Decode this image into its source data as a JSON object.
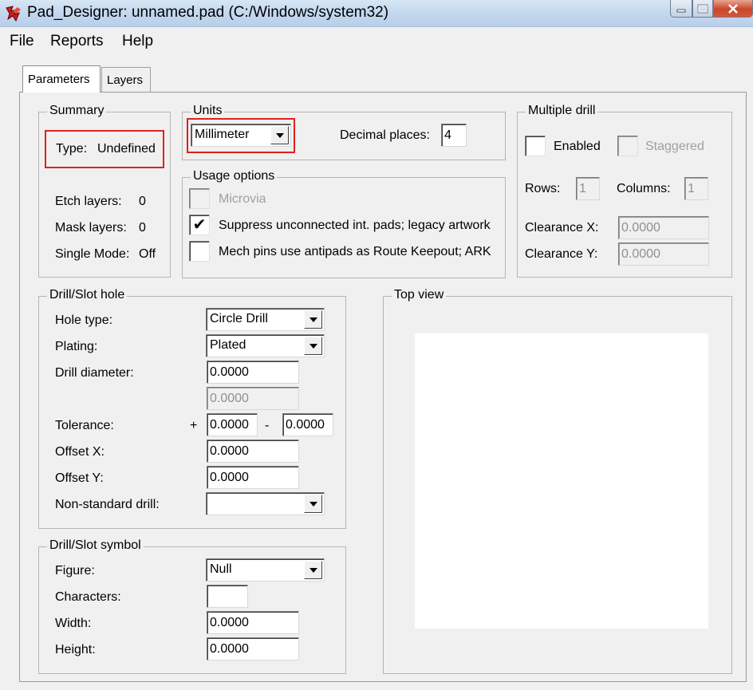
{
  "window": {
    "title": "Pad_Designer: unnamed.pad (C:/Windows/system32)"
  },
  "menu": [
    "File",
    "Reports",
    "Help"
  ],
  "tabs": [
    "Parameters",
    "Layers"
  ],
  "summary": {
    "title": "Summary",
    "type_label": "Type:",
    "type_value": "Undefined",
    "etch_label": "Etch layers:",
    "etch_value": "0",
    "mask_label": "Mask layers:",
    "mask_value": "0",
    "single_label": "Single Mode:",
    "single_value": "Off"
  },
  "units": {
    "title": "Units",
    "unit_value": "Millimeter",
    "decimal_label": "Decimal places:",
    "decimal_value": "4"
  },
  "usage": {
    "title": "Usage options",
    "microvia": "Microvia",
    "suppress": "Suppress unconnected int. pads; legacy artwork",
    "mech": "Mech pins use antipads as Route Keepout; ARK",
    "suppress_checked": "✔"
  },
  "multi": {
    "title": "Multiple drill",
    "enabled": "Enabled",
    "staggered": "Staggered",
    "rows_label": "Rows:",
    "rows_value": "1",
    "cols_label": "Columns:",
    "cols_value": "1",
    "clrx_label": "Clearance X:",
    "clrx_value": "0.0000",
    "clry_label": "Clearance Y:",
    "clry_value": "0.0000"
  },
  "drill": {
    "title": "Drill/Slot hole",
    "hole_label": "Hole type:",
    "hole_value": "Circle Drill",
    "plating_label": "Plating:",
    "plating_value": "Plated",
    "diam_label": "Drill diameter:",
    "diam_value": "0.0000",
    "diam2_value": "0.0000",
    "tol_label": "Tolerance:",
    "plus": "+",
    "minus": "-",
    "tol_plus": "0.0000",
    "tol_minus": "0.0000",
    "offx_label": "Offset X:",
    "offx_value": "0.0000",
    "offy_label": "Offset Y:",
    "offy_value": "0.0000",
    "nonstd_label": "Non-standard drill:",
    "nonstd_value": ""
  },
  "symbol": {
    "title": "Drill/Slot symbol",
    "figure_label": "Figure:",
    "figure_value": "Null",
    "chars_label": "Characters:",
    "chars_value": "",
    "width_label": "Width:",
    "width_value": "0.0000",
    "height_label": "Height:",
    "height_value": "0.0000"
  },
  "topview": {
    "title": "Top view"
  }
}
